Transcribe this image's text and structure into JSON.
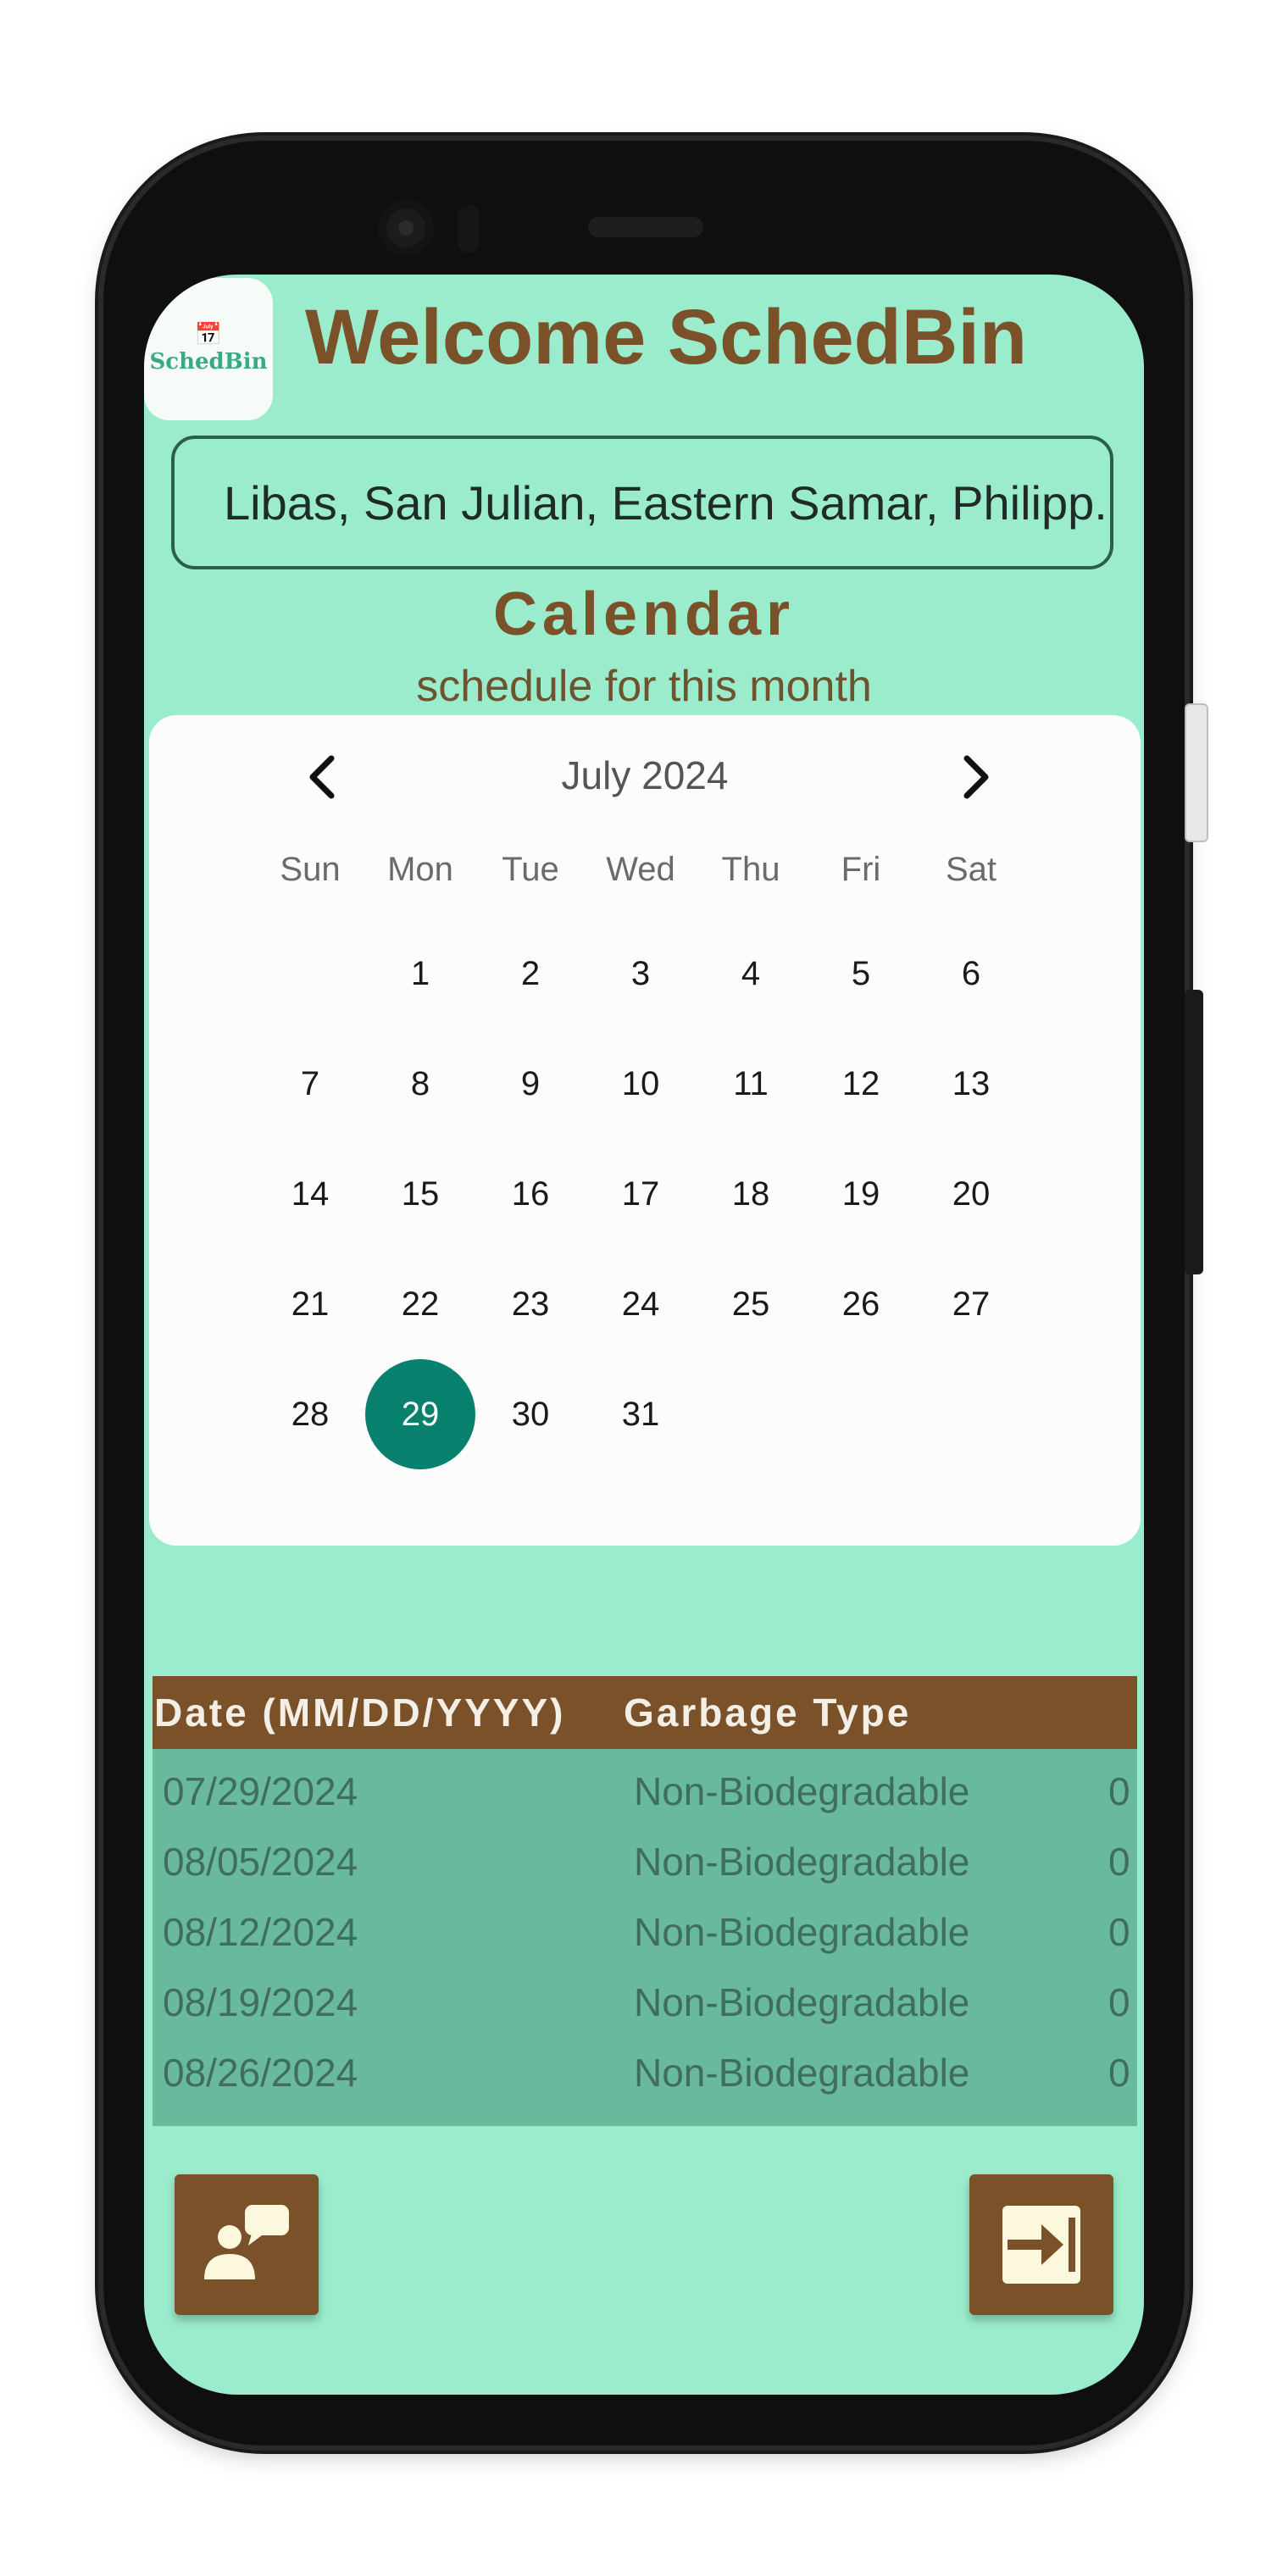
{
  "header": {
    "logo_text": "SchedBin",
    "welcome": "Welcome SchedBin"
  },
  "location": {
    "value": "Libas, San Julian, Eastern Samar, Philipp. ."
  },
  "calendar": {
    "title": "Calendar",
    "subtitle": "schedule for this month",
    "month": "July 2024",
    "prev_icon": "chevron-left-icon",
    "next_icon": "chevron-right-icon",
    "weekdays": [
      "Sun",
      "Mon",
      "Tue",
      "Wed",
      "Thu",
      "Fri",
      "Sat"
    ],
    "first_day_offset": 1,
    "days_in_month": 31,
    "selected_day": "29",
    "days": [
      "1",
      "2",
      "3",
      "4",
      "5",
      "6",
      "7",
      "8",
      "9",
      "10",
      "11",
      "12",
      "13",
      "14",
      "15",
      "16",
      "17",
      "18",
      "19",
      "20",
      "21",
      "22",
      "23",
      "24",
      "25",
      "26",
      "27",
      "28",
      "29",
      "30",
      "31"
    ]
  },
  "table": {
    "headers": [
      "Date (MM/DD/YYYY)",
      "Garbage Type"
    ],
    "rows": [
      {
        "date": "07/29/2024",
        "type": "Non-Biodegradable",
        "extra": "0"
      },
      {
        "date": "08/05/2024",
        "type": "Non-Biodegradable",
        "extra": "0"
      },
      {
        "date": "08/12/2024",
        "type": "Non-Biodegradable",
        "extra": "0"
      },
      {
        "date": "08/19/2024",
        "type": "Non-Biodegradable",
        "extra": "0"
      },
      {
        "date": "08/26/2024",
        "type": "Non-Biodegradable",
        "extra": "0"
      }
    ]
  },
  "buttons": {
    "left_icon": "chat-feedback-icon",
    "right_icon": "logout-icon"
  },
  "colors": {
    "screen_bg": "#9aeccc",
    "brand_brown": "#7a5128",
    "selected_day": "#07806e",
    "table_body": "#69b99d"
  }
}
